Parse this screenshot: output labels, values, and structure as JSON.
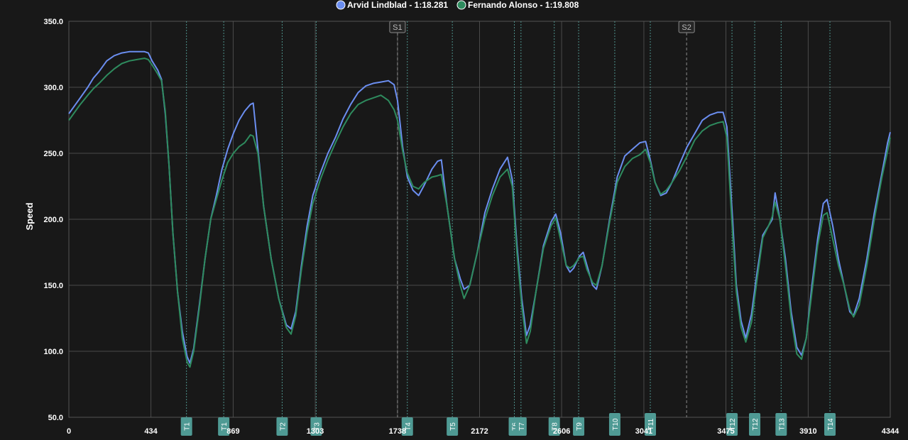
{
  "chart_data": {
    "type": "line",
    "ylabel": "Speed",
    "ylim": [
      50,
      350
    ],
    "yticks": [
      "50.0",
      "100.0",
      "150.0",
      "200.0",
      "250.0",
      "300.0",
      "350.0"
    ],
    "xlim": [
      0,
      4344
    ],
    "xticks": [
      {
        "v": 0,
        "label": "0"
      },
      {
        "v": 434,
        "label": "434"
      },
      {
        "v": 869,
        "label": "869"
      },
      {
        "v": 1303,
        "label": "1303"
      },
      {
        "v": 1738,
        "label": "1738"
      },
      {
        "v": 2172,
        "label": "2172"
      },
      {
        "v": 2606,
        "label": "2606"
      },
      {
        "v": 3041,
        "label": "3041"
      },
      {
        "v": 3475,
        "label": "3475"
      },
      {
        "v": 3910,
        "label": "3910"
      },
      {
        "v": 4344,
        "label": "4344"
      }
    ],
    "grid": true,
    "legend_position": "top-center",
    "sectors": [
      {
        "label": "S1",
        "x": 1738
      },
      {
        "label": "S2",
        "x": 3267
      }
    ],
    "corners": [
      {
        "label": "T1",
        "x": 622
      },
      {
        "label": "T1",
        "x": 819
      },
      {
        "label": "T2",
        "x": 1128
      },
      {
        "label": "T3",
        "x": 1308
      },
      {
        "label": "T4",
        "x": 1790
      },
      {
        "label": "T5",
        "x": 2028
      },
      {
        "label": "T6",
        "x": 2356
      },
      {
        "label": "T7",
        "x": 2391
      },
      {
        "label": "T8",
        "x": 2567
      },
      {
        "label": "T9",
        "x": 2696
      },
      {
        "label": "T10",
        "x": 2887
      },
      {
        "label": "T11",
        "x": 3075
      },
      {
        "label": "T12",
        "x": 3507
      },
      {
        "label": "T12",
        "x": 3627
      },
      {
        "label": "T13",
        "x": 3767
      },
      {
        "label": "T14",
        "x": 4025
      }
    ],
    "series": [
      {
        "name": "Arvid Lindblad - 1:18.281",
        "color": "#6b8ef0",
        "points": [
          [
            0,
            280
          ],
          [
            60,
            292
          ],
          [
            100,
            300
          ],
          [
            130,
            307
          ],
          [
            160,
            312
          ],
          [
            200,
            320
          ],
          [
            240,
            324
          ],
          [
            280,
            326
          ],
          [
            320,
            327
          ],
          [
            360,
            327
          ],
          [
            400,
            327
          ],
          [
            420,
            326
          ],
          [
            440,
            320
          ],
          [
            470,
            313
          ],
          [
            490,
            306
          ],
          [
            510,
            280
          ],
          [
            530,
            240
          ],
          [
            550,
            190
          ],
          [
            575,
            145
          ],
          [
            600,
            115
          ],
          [
            625,
            96
          ],
          [
            640,
            91
          ],
          [
            660,
            102
          ],
          [
            690,
            135
          ],
          [
            720,
            170
          ],
          [
            750,
            200
          ],
          [
            780,
            218
          ],
          [
            810,
            238
          ],
          [
            840,
            253
          ],
          [
            870,
            265
          ],
          [
            900,
            275
          ],
          [
            930,
            282
          ],
          [
            960,
            287
          ],
          [
            975,
            288
          ],
          [
            1000,
            253
          ],
          [
            1030,
            210
          ],
          [
            1070,
            170
          ],
          [
            1110,
            140
          ],
          [
            1150,
            120
          ],
          [
            1175,
            117
          ],
          [
            1200,
            130
          ],
          [
            1230,
            165
          ],
          [
            1260,
            195
          ],
          [
            1290,
            218
          ],
          [
            1330,
            235
          ],
          [
            1370,
            250
          ],
          [
            1410,
            262
          ],
          [
            1450,
            276
          ],
          [
            1490,
            287
          ],
          [
            1530,
            296
          ],
          [
            1570,
            301
          ],
          [
            1610,
            303
          ],
          [
            1650,
            304
          ],
          [
            1690,
            305
          ],
          [
            1720,
            302
          ],
          [
            1738,
            290
          ],
          [
            1750,
            275
          ],
          [
            1765,
            255
          ],
          [
            1790,
            232
          ],
          [
            1820,
            222
          ],
          [
            1850,
            218
          ],
          [
            1880,
            226
          ],
          [
            1920,
            238
          ],
          [
            1950,
            244
          ],
          [
            1970,
            245
          ],
          [
            2000,
            210
          ],
          [
            2040,
            170
          ],
          [
            2070,
            155
          ],
          [
            2090,
            147
          ],
          [
            2120,
            150
          ],
          [
            2160,
            175
          ],
          [
            2200,
            205
          ],
          [
            2240,
            223
          ],
          [
            2280,
            238
          ],
          [
            2320,
            247
          ],
          [
            2345,
            230
          ],
          [
            2370,
            180
          ],
          [
            2395,
            140
          ],
          [
            2420,
            112
          ],
          [
            2440,
            120
          ],
          [
            2470,
            145
          ],
          [
            2510,
            180
          ],
          [
            2550,
            198
          ],
          [
            2575,
            204
          ],
          [
            2600,
            190
          ],
          [
            2630,
            165
          ],
          [
            2650,
            160
          ],
          [
            2670,
            163
          ],
          [
            2700,
            172
          ],
          [
            2720,
            175
          ],
          [
            2740,
            165
          ],
          [
            2770,
            150
          ],
          [
            2790,
            147
          ],
          [
            2820,
            165
          ],
          [
            2860,
            200
          ],
          [
            2900,
            232
          ],
          [
            2940,
            248
          ],
          [
            2980,
            253
          ],
          [
            3020,
            258
          ],
          [
            3050,
            259
          ],
          [
            3075,
            245
          ],
          [
            3100,
            228
          ],
          [
            3130,
            218
          ],
          [
            3160,
            220
          ],
          [
            3190,
            228
          ],
          [
            3230,
            242
          ],
          [
            3270,
            255
          ],
          [
            3310,
            265
          ],
          [
            3350,
            275
          ],
          [
            3390,
            279
          ],
          [
            3430,
            281
          ],
          [
            3460,
            281
          ],
          [
            3480,
            270
          ],
          [
            3510,
            200
          ],
          [
            3530,
            150
          ],
          [
            3555,
            123
          ],
          [
            3580,
            110
          ],
          [
            3610,
            128
          ],
          [
            3640,
            160
          ],
          [
            3670,
            188
          ],
          [
            3700,
            195
          ],
          [
            3720,
            200
          ],
          [
            3735,
            220
          ],
          [
            3760,
            200
          ],
          [
            3790,
            170
          ],
          [
            3820,
            130
          ],
          [
            3850,
            103
          ],
          [
            3875,
            97
          ],
          [
            3900,
            110
          ],
          [
            3930,
            150
          ],
          [
            3960,
            185
          ],
          [
            3990,
            212
          ],
          [
            4010,
            215
          ],
          [
            4040,
            195
          ],
          [
            4070,
            170
          ],
          [
            4100,
            150
          ],
          [
            4130,
            130
          ],
          [
            4150,
            127
          ],
          [
            4180,
            140
          ],
          [
            4220,
            170
          ],
          [
            4260,
            205
          ],
          [
            4300,
            235
          ],
          [
            4330,
            258
          ],
          [
            4344,
            266
          ]
        ]
      },
      {
        "name": "Fernando Alonso - 1:19.808",
        "color": "#2e8b5e",
        "points": [
          [
            0,
            275
          ],
          [
            60,
            287
          ],
          [
            100,
            294
          ],
          [
            130,
            299
          ],
          [
            160,
            303
          ],
          [
            200,
            309
          ],
          [
            240,
            314
          ],
          [
            280,
            318
          ],
          [
            320,
            320
          ],
          [
            360,
            321
          ],
          [
            400,
            322
          ],
          [
            420,
            321
          ],
          [
            440,
            317
          ],
          [
            470,
            310
          ],
          [
            490,
            305
          ],
          [
            510,
            282
          ],
          [
            530,
            240
          ],
          [
            550,
            190
          ],
          [
            575,
            145
          ],
          [
            600,
            110
          ],
          [
            625,
            92
          ],
          [
            640,
            88
          ],
          [
            660,
            100
          ],
          [
            690,
            133
          ],
          [
            720,
            170
          ],
          [
            750,
            200
          ],
          [
            780,
            215
          ],
          [
            810,
            230
          ],
          [
            840,
            243
          ],
          [
            870,
            250
          ],
          [
            900,
            255
          ],
          [
            930,
            258
          ],
          [
            960,
            264
          ],
          [
            975,
            263
          ],
          [
            1000,
            250
          ],
          [
            1030,
            210
          ],
          [
            1070,
            170
          ],
          [
            1110,
            140
          ],
          [
            1150,
            118
          ],
          [
            1175,
            113
          ],
          [
            1200,
            127
          ],
          [
            1230,
            162
          ],
          [
            1260,
            190
          ],
          [
            1290,
            212
          ],
          [
            1330,
            230
          ],
          [
            1370,
            245
          ],
          [
            1410,
            258
          ],
          [
            1450,
            270
          ],
          [
            1490,
            280
          ],
          [
            1530,
            287
          ],
          [
            1570,
            290
          ],
          [
            1610,
            292
          ],
          [
            1650,
            294
          ],
          [
            1690,
            290
          ],
          [
            1720,
            283
          ],
          [
            1738,
            275
          ],
          [
            1750,
            265
          ],
          [
            1765,
            252
          ],
          [
            1790,
            235
          ],
          [
            1820,
            225
          ],
          [
            1850,
            223
          ],
          [
            1880,
            228
          ],
          [
            1920,
            232
          ],
          [
            1950,
            233
          ],
          [
            1970,
            234
          ],
          [
            2000,
            210
          ],
          [
            2040,
            170
          ],
          [
            2070,
            150
          ],
          [
            2090,
            140
          ],
          [
            2120,
            150
          ],
          [
            2160,
            175
          ],
          [
            2200,
            200
          ],
          [
            2240,
            218
          ],
          [
            2280,
            232
          ],
          [
            2320,
            238
          ],
          [
            2345,
            225
          ],
          [
            2370,
            175
          ],
          [
            2395,
            135
          ],
          [
            2420,
            106
          ],
          [
            2440,
            115
          ],
          [
            2470,
            145
          ],
          [
            2510,
            178
          ],
          [
            2550,
            195
          ],
          [
            2575,
            201
          ],
          [
            2600,
            185
          ],
          [
            2630,
            165
          ],
          [
            2650,
            163
          ],
          [
            2670,
            165
          ],
          [
            2700,
            171
          ],
          [
            2720,
            172
          ],
          [
            2740,
            162
          ],
          [
            2770,
            152
          ],
          [
            2790,
            150
          ],
          [
            2820,
            165
          ],
          [
            2860,
            198
          ],
          [
            2900,
            228
          ],
          [
            2940,
            240
          ],
          [
            2980,
            246
          ],
          [
            3020,
            249
          ],
          [
            3050,
            253
          ],
          [
            3075,
            243
          ],
          [
            3100,
            228
          ],
          [
            3130,
            219
          ],
          [
            3160,
            222
          ],
          [
            3190,
            228
          ],
          [
            3230,
            237
          ],
          [
            3270,
            248
          ],
          [
            3310,
            260
          ],
          [
            3350,
            267
          ],
          [
            3390,
            271
          ],
          [
            3430,
            273
          ],
          [
            3460,
            274
          ],
          [
            3480,
            262
          ],
          [
            3510,
            190
          ],
          [
            3530,
            145
          ],
          [
            3555,
            118
          ],
          [
            3580,
            107
          ],
          [
            3610,
            122
          ],
          [
            3640,
            155
          ],
          [
            3670,
            186
          ],
          [
            3700,
            195
          ],
          [
            3720,
            202
          ],
          [
            3735,
            213
          ],
          [
            3760,
            200
          ],
          [
            3790,
            165
          ],
          [
            3820,
            125
          ],
          [
            3850,
            98
          ],
          [
            3875,
            94
          ],
          [
            3900,
            110
          ],
          [
            3930,
            145
          ],
          [
            3960,
            180
          ],
          [
            3990,
            203
          ],
          [
            4010,
            205
          ],
          [
            4040,
            185
          ],
          [
            4070,
            165
          ],
          [
            4100,
            150
          ],
          [
            4130,
            132
          ],
          [
            4150,
            126
          ],
          [
            4180,
            135
          ],
          [
            4220,
            165
          ],
          [
            4260,
            200
          ],
          [
            4300,
            232
          ],
          [
            4330,
            252
          ],
          [
            4344,
            262
          ]
        ]
      }
    ]
  }
}
